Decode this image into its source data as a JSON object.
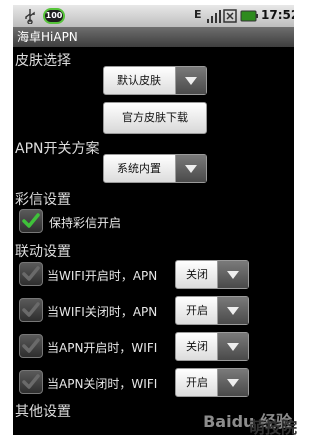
{
  "status_bar": {
    "usb_icon": "usb-icon",
    "badge_text": "100",
    "network_label": "E",
    "signal_icon": "signal-icon",
    "gsm_icon": "gsm-icon",
    "battery_icon": "battery-icon",
    "time": "17:52"
  },
  "app": {
    "title": "海卓HiAPN"
  },
  "skin": {
    "section_label": "皮肤选择",
    "selected": "默认皮肤",
    "download_button": "官方皮肤下载"
  },
  "apn_scheme": {
    "section_label": "APN开关方案",
    "selected": "系统内置"
  },
  "mms": {
    "section_label": "彩信设置",
    "keep_mms_on_label": "保持彩信开启",
    "keep_mms_on_checked": true
  },
  "linkage": {
    "section_label": "联动设置",
    "rows": [
      {
        "label": "当WIFI开启时，APN",
        "selected": "关闭",
        "checked": false
      },
      {
        "label": "当WIFI关闭时，APN",
        "selected": "开启",
        "checked": false
      },
      {
        "label": "当APN开启时，WIFI",
        "selected": "关闭",
        "checked": false
      },
      {
        "label": "当APN关闭时，WIFI",
        "selected": "开启",
        "checked": false
      }
    ]
  },
  "other": {
    "section_label": "其他设置"
  },
  "watermark": "Baidu 经验",
  "corner_logo": "萌技院",
  "colors": {
    "check_green": "#3fc13a",
    "accent_badge_green": "#56c43a"
  }
}
